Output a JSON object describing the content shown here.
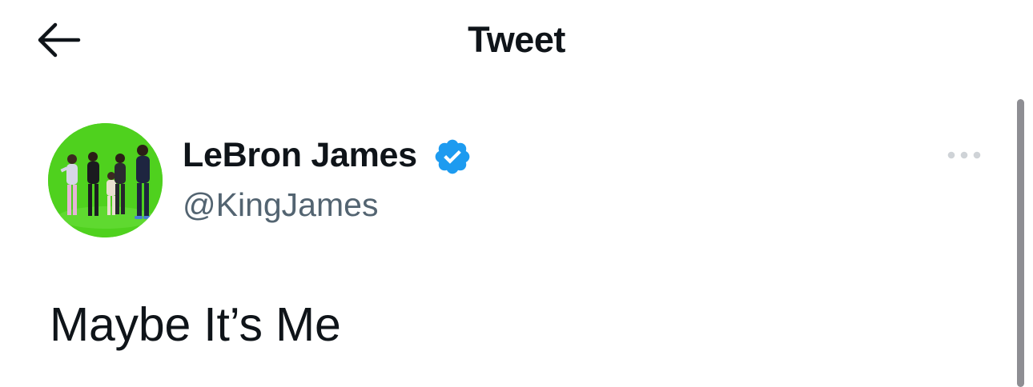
{
  "header": {
    "back_icon": "arrow-left-icon",
    "title": "Tweet"
  },
  "tweet": {
    "author_name": "LeBron James",
    "verified_icon": "verified-badge-icon",
    "verified_color": "#1d9bf0",
    "handle": "@KingJames",
    "more_icon": "more-horizontal-icon",
    "text": "Maybe It’s Me"
  },
  "colors": {
    "background": "#ffffff",
    "text_primary": "#0f1419",
    "text_secondary": "#536471",
    "avatar_background": "#4fd11e"
  }
}
